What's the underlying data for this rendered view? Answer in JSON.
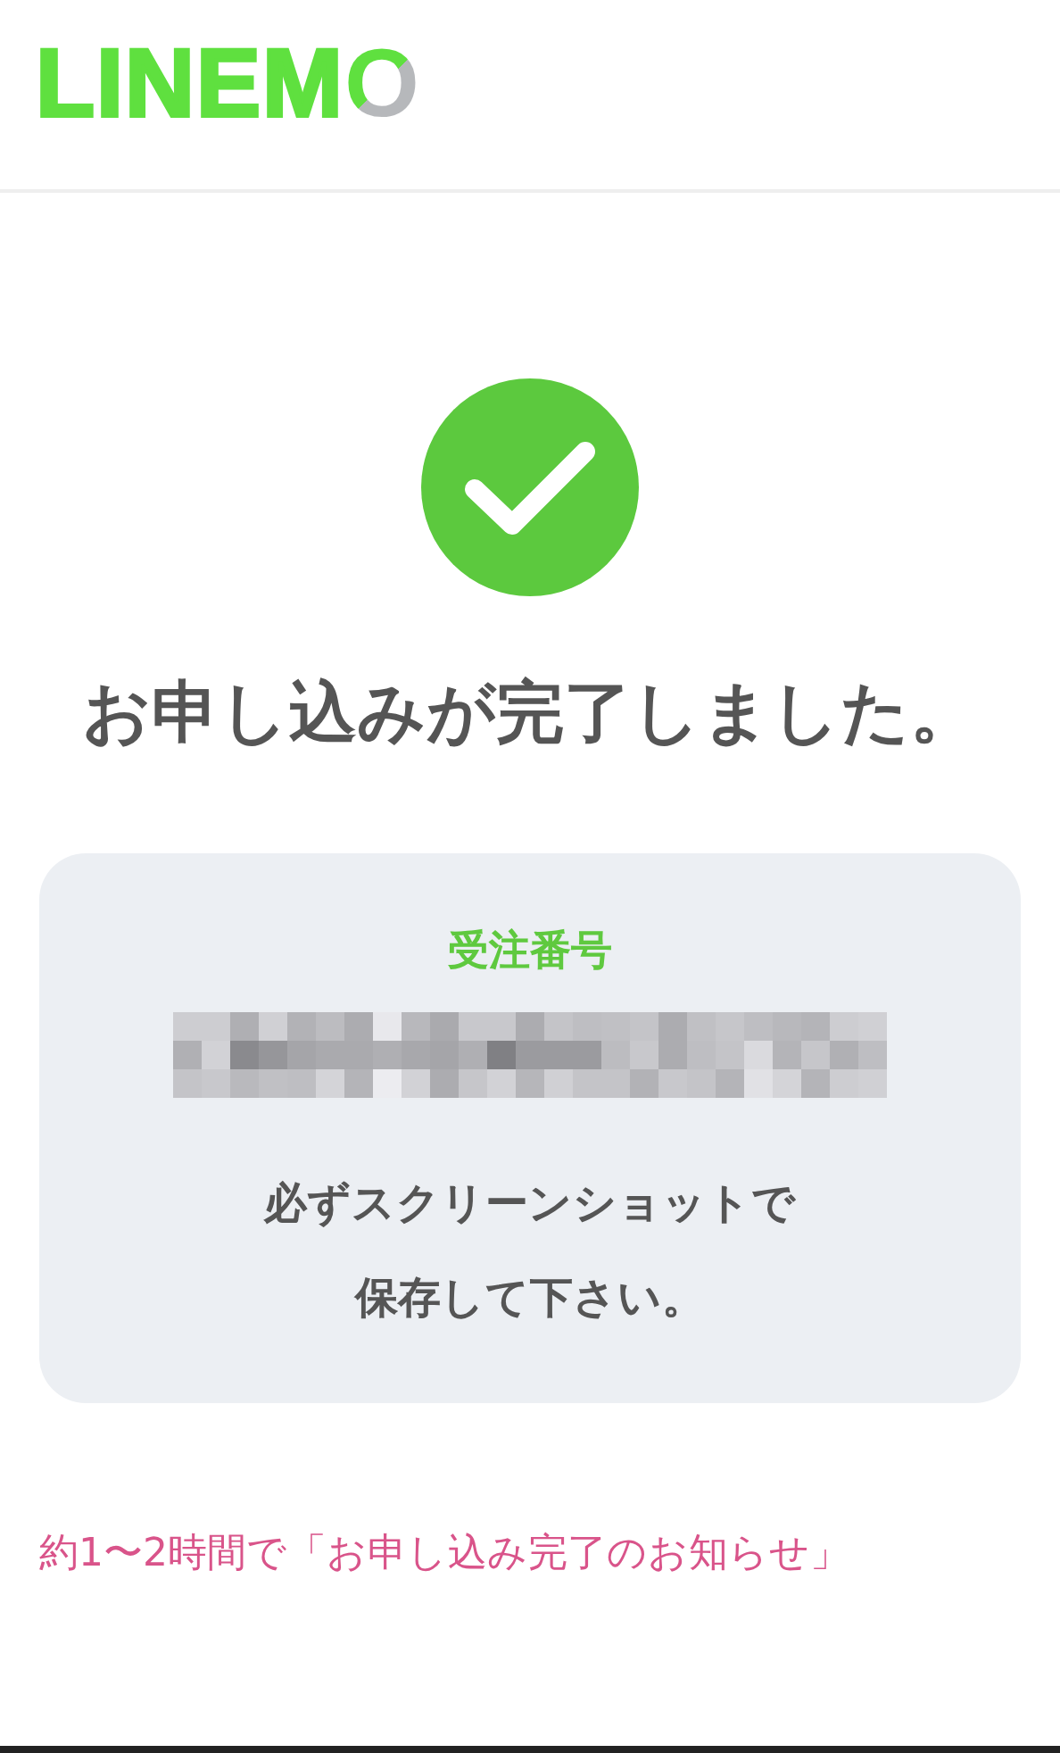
{
  "header": {
    "logo": "LINEMO"
  },
  "title": "お申し込みが完了しました。",
  "order_card": {
    "label": "受注番号",
    "note_lines": [
      "必ずスクリーンショットで",
      "保存して下さい。"
    ]
  },
  "notice": "約1〜2時間で「お申し込み完了のお知らせ」"
}
